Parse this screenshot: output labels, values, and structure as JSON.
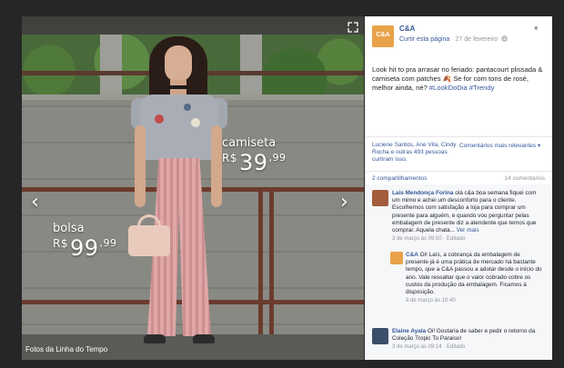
{
  "photo": {
    "caption": "Fotos da Linha do Tempo",
    "labels": [
      {
        "name": "camiseta",
        "currency": "R$",
        "whole": "39",
        "cents": ",99"
      },
      {
        "name": "bolsa",
        "currency": "R$",
        "whole": "99",
        "cents": ",99"
      }
    ],
    "prev_arrow": "‹",
    "next_arrow": "›"
  },
  "post": {
    "logo_text": "C&A",
    "page_name": "C&A",
    "follow_link": "Curtir esta página",
    "date": "27 de fevereiro",
    "globe_icon": "globe-icon",
    "more_icon": "chevron-down-icon",
    "text": "Look hit to pra arrasar no feriado: pantacourt plissada & camiseta com patches 🍂 Se for com tons de rosé, melhor ainda, né? ",
    "hashtags": "#LookDoDia #Trendy",
    "reactions": "Luciene Santos, Ane Vila, Cindy Rocha e outras 493 pessoas curtiram isso.",
    "relevance": "Comentários mais relevantes ▾",
    "shares": "2 compartilhamentos",
    "comments_count": "14 comentários"
  },
  "comments": [
    {
      "author": "Lais Mendonça Forina",
      "text": "olá c&a boa semana fiquei com um mimo e achei um desconforto para o cliente. Escolhemos com satisfação a loja para comprar um presente para alguém, e quando vou perguntar pelas embalagem de presente diz a atendente que temos que comprar. Aquela chata... ",
      "more": "Ver mais",
      "meta": "3 de março às 09:50 · Editado"
    },
    {
      "author": "C&A",
      "text": "Oi! Laís, a cobrança da embalagem de presente já é uma prática de mercado há bastante tempo, que a C&A passou a adotar desde o início do ano. Vale ressaltar que o valor cobrado cobre os custos da produção da embalagem. Ficamos à disposição.",
      "more": "",
      "meta": "9 de março às 10:40"
    },
    {
      "author": "Elaine Ayala",
      "text": "Oi! Gostaria de saber e pedir o retorno da Coleção Tropic To Paraiso!",
      "more": "",
      "meta": "3 de março às 09:14 · Editado"
    }
  ],
  "colors": {
    "link": "#365899",
    "brand_orange": "#e8a24a",
    "muted": "#90949c"
  }
}
